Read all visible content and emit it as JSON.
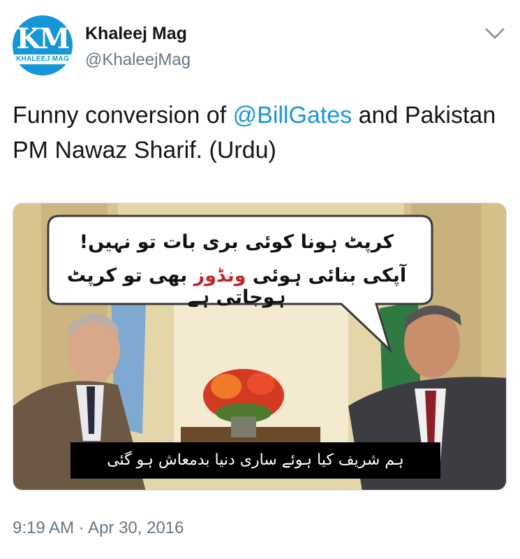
{
  "account": {
    "avatar_monogram": "KM",
    "avatar_band_text": "KHALEEJ MAG",
    "name": "Khaleej Mag",
    "handle": "@KhaleejMag"
  },
  "tweet": {
    "text_before": "Funny conversion of ",
    "mention": "@BillGates",
    "text_after": " and Pakistan PM Nawaz Sharif. (Urdu)",
    "timestamp": "9:19 AM · Apr 30, 2016"
  },
  "media": {
    "bubble_line1": "کرپٹ ہونا کوئی بری بات تو نہیں!",
    "bubble_line2_part1": "آپکی بنائی ہوئی ",
    "bubble_line2_red": "ونڈوز",
    "bubble_line2_part2": " بھی تو کرپٹ ہوجاتی ہے",
    "subtitle": "ہم شریف کیا ہوئے ساری دنیا بدمعاش ہو گئی"
  },
  "colors": {
    "link": "#1b95e0",
    "secondary_text": "#657786",
    "avatar_blue": "#1596d6",
    "highlight_red": "#c0272d"
  },
  "icons": {
    "caret": "chevron-down-icon"
  }
}
